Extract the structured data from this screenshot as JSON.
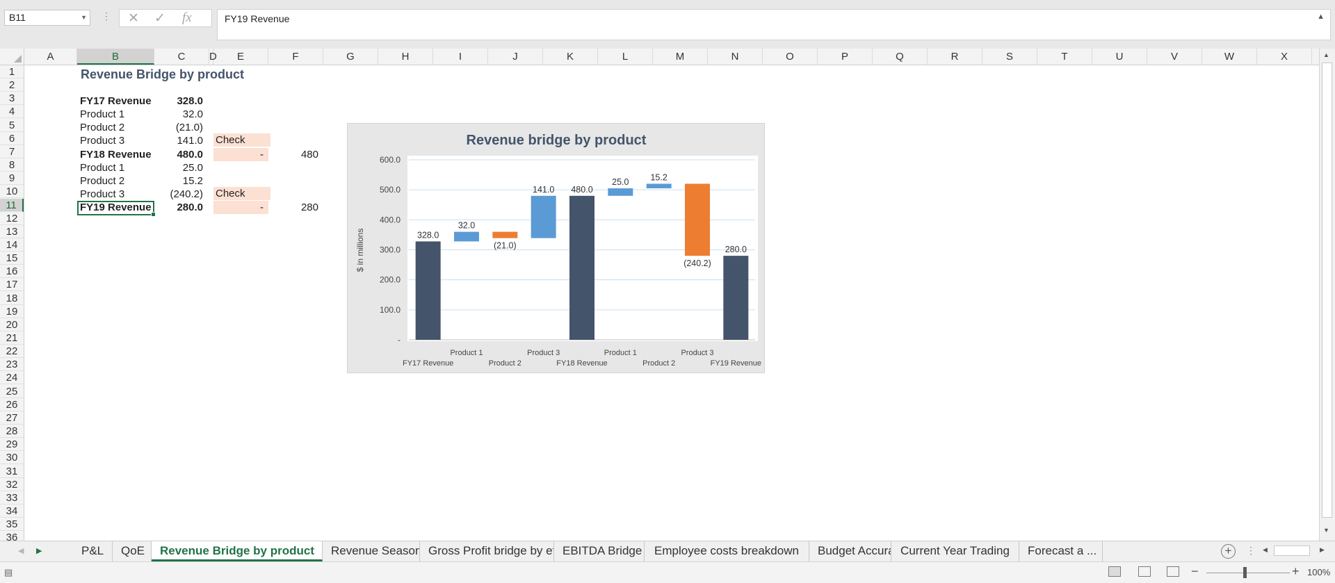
{
  "formula_bar": {
    "name_box": "B11",
    "formula": "FY19 Revenue"
  },
  "columns": [
    "A",
    "B",
    "C",
    "D",
    "E",
    "F",
    "G",
    "H",
    "I",
    "J",
    "K",
    "L",
    "M",
    "N",
    "O",
    "P",
    "Q",
    "R",
    "S",
    "T",
    "U",
    "V",
    "W",
    "X"
  ],
  "selected_column": "B",
  "rows": [
    "1",
    "2",
    "3",
    "4",
    "5",
    "6",
    "7",
    "8",
    "9",
    "10",
    "11",
    "12",
    "13",
    "14",
    "15",
    "16",
    "17",
    "18",
    "19",
    "20",
    "21",
    "22",
    "23",
    "24",
    "25",
    "26",
    "27",
    "28",
    "29",
    "30",
    "31",
    "32",
    "33",
    "34",
    "35",
    "36"
  ],
  "selected_row": "11",
  "sheet": {
    "title": "Revenue Bridge by product",
    "rows": [
      {
        "label": "FY17 Revenue",
        "value": "328.0",
        "bold": true
      },
      {
        "label": "Product 1",
        "value": "32.0"
      },
      {
        "label": "Product 2",
        "value": "(21.0)"
      },
      {
        "label": "Product 3",
        "value": "141.0",
        "check": "Check"
      },
      {
        "label": "FY18 Revenue",
        "value": "480.0",
        "bold": true,
        "check_value": "-",
        "total": "480"
      },
      {
        "label": "Product 1",
        "value": "25.0"
      },
      {
        "label": "Product 2",
        "value": "15.2"
      },
      {
        "label": "Product 3",
        "value": "(240.2)",
        "check": "Check"
      },
      {
        "label": "FY19 Revenue",
        "value": "280.0",
        "bold": true,
        "check_value": "-",
        "total": "280"
      }
    ]
  },
  "chart_data": {
    "type": "bar",
    "title": "Revenue bridge by product",
    "ylabel": "$ in millions",
    "xlabel": "",
    "ylim": [
      0,
      600
    ],
    "yticks": [
      "-",
      "100.0",
      "200.0",
      "300.0",
      "400.0",
      "500.0",
      "600.0"
    ],
    "categories": [
      "FY17 Revenue",
      "Product 1",
      "Product 2",
      "Product 3",
      "FY18 Revenue",
      "Product 1",
      "Product 2",
      "Product 3",
      "FY19 Revenue"
    ],
    "bars": [
      {
        "start": 0,
        "end": 328.0,
        "kind": "total",
        "label": "328.0"
      },
      {
        "start": 328.0,
        "end": 360.0,
        "kind": "increase",
        "label": "32.0"
      },
      {
        "start": 339.0,
        "end": 360.0,
        "kind": "decrease",
        "label": "(21.0)"
      },
      {
        "start": 339.0,
        "end": 480.0,
        "kind": "increase",
        "label": "141.0"
      },
      {
        "start": 0,
        "end": 480.0,
        "kind": "total",
        "label": "480.0"
      },
      {
        "start": 480.0,
        "end": 505.0,
        "kind": "increase",
        "label": "25.0"
      },
      {
        "start": 505.0,
        "end": 520.2,
        "kind": "increase",
        "label": "15.2"
      },
      {
        "start": 280.0,
        "end": 520.2,
        "kind": "decrease",
        "label": "(240.2)"
      },
      {
        "start": 0,
        "end": 280.0,
        "kind": "total",
        "label": "280.0"
      }
    ],
    "colors": {
      "total": "#44546a",
      "increase": "#5b9bd5",
      "decrease": "#ed7d31"
    },
    "grid": true
  },
  "tabs": [
    "P&L",
    "QoE",
    "Revenue Bridge by product",
    "Revenue Seasonality",
    "Gross Profit bridge by effect",
    "EBITDA Bridge",
    "Employee costs breakdown",
    "Budget Accuracy",
    "Current Year Trading",
    "Forecast a ..."
  ],
  "active_tab": "Revenue Bridge by product",
  "status": {
    "zoom": "100%",
    "view": "normal"
  }
}
